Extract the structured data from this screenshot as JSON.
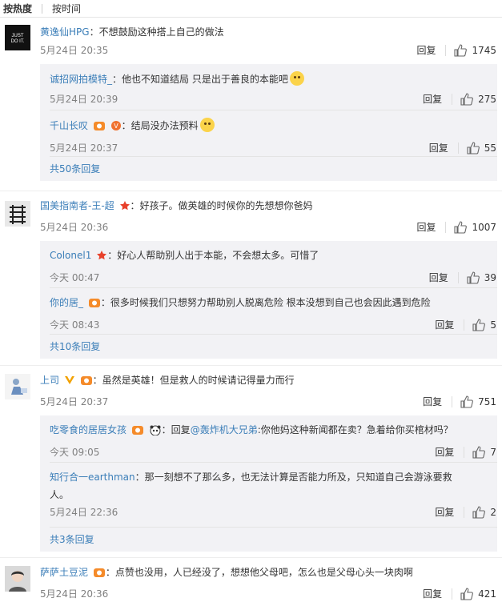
{
  "tabs": {
    "hot": "按热度",
    "time": "按时间"
  },
  "comments": [
    {
      "user": "黄逸仙HPG",
      "text": "：不想鼓励这种搭上自己的做法",
      "time": "5月24日 20:35",
      "reply": "回复",
      "likes": "1745",
      "replies": [
        {
          "user": "诚招网拍模特_",
          "text": "：他也不知道结局 只是出于善良的本能吧",
          "time": "5月24日 20:39",
          "reply": "回复",
          "likes": "275"
        },
        {
          "user": "千山长叹",
          "text": "：结局没办法预料",
          "time": "5月24日 20:37",
          "reply": "回复",
          "likes": "55"
        }
      ],
      "more": "共50条回复"
    },
    {
      "user": "国美指南者-王-超",
      "text": "：好孩子。做英雄的时候你的先想想你爸妈",
      "time": "5月24日 20:36",
      "reply": "回复",
      "likes": "1007",
      "replies": [
        {
          "user": "Colonel1",
          "text": "：好心人帮助别人出于本能，不会想太多。可惜了",
          "time": "今天 00:47",
          "reply": "回复",
          "likes": "39"
        },
        {
          "user": "你的居_",
          "text": "：很多时候我们只想努力帮助别人脱离危险  根本没想到自己也会因此遇到危险",
          "time": "今天 08:43",
          "reply": "回复",
          "likes": "5"
        }
      ],
      "more": "共10条回复"
    },
    {
      "user": "上司",
      "text": "：虽然是英雄！但是救人的时候请记得量力而行",
      "time": "5月24日 20:37",
      "reply": "回复",
      "likes": "751",
      "replies": [
        {
          "user": "吃零食的居居女孩",
          "text": "：回复",
          "mention": "@轰炸机大兄弟",
          "text2": ":你他妈这种新闻都在卖？急着给你买棺材吗？",
          "time": "今天 09:05",
          "reply": "回复",
          "likes": "7"
        },
        {
          "user": "知行合一earthman",
          "text": "：那一刻想不了那么多，也无法计算是否能力所及，只知道自己会游泳要救",
          "text_cont": "人。",
          "time": "5月24日 22:36",
          "reply": "回复",
          "likes": "2"
        }
      ],
      "more": "共3条回复"
    },
    {
      "user": "萨萨土豆泥",
      "text": "：点赞也没用，人已经没了，想想他父母吧，怎么也是父母心头一块肉啊",
      "time": "5月24日 20:36",
      "reply": "回复",
      "likes": "421"
    }
  ],
  "avatar_labels": {
    "a0": "JUST DO IT."
  },
  "colors": {
    "link": "#3b7eb8",
    "subbg": "#f2f2f5",
    "meta": "#808080"
  }
}
